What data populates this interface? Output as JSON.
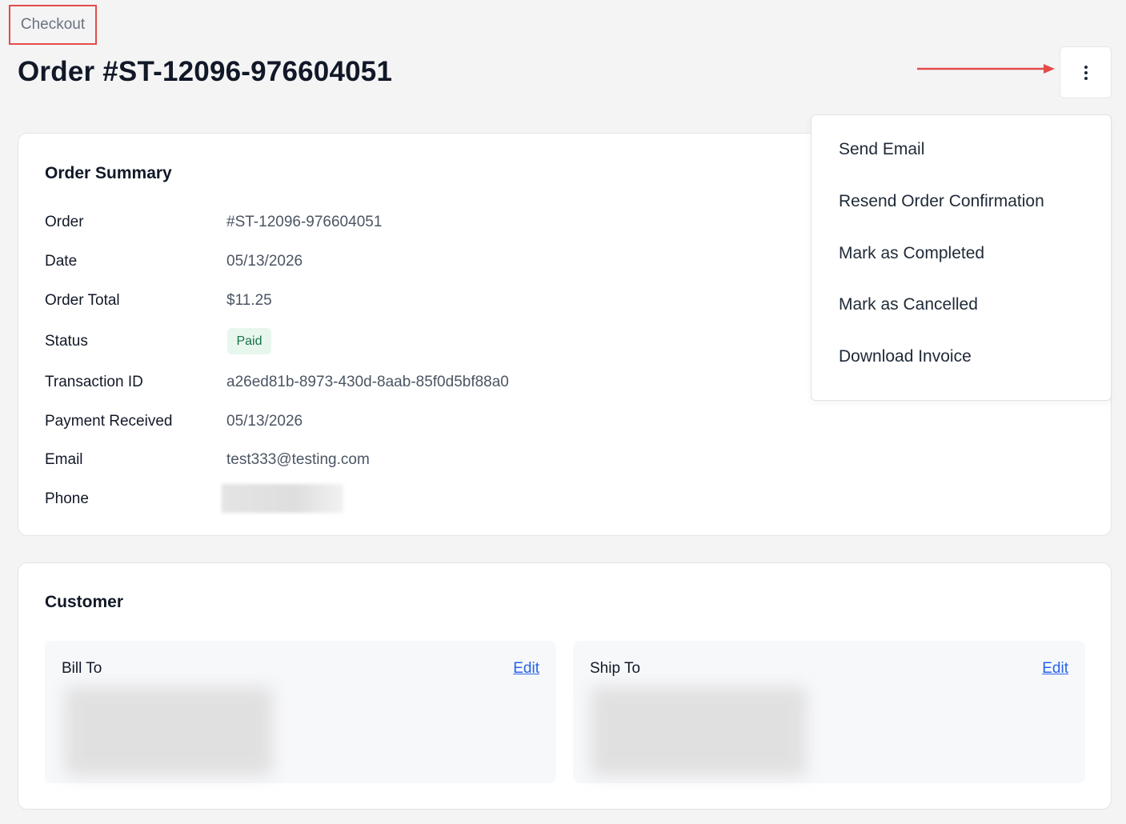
{
  "breadcrumb": {
    "label": "Checkout"
  },
  "page": {
    "title": "Order #ST-12096-976604051"
  },
  "more_menu": {
    "items": [
      {
        "label": "Send Email"
      },
      {
        "label": "Resend Order Confirmation"
      },
      {
        "label": "Mark as Completed"
      },
      {
        "label": "Mark as Cancelled"
      },
      {
        "label": "Download Invoice"
      }
    ]
  },
  "order_summary": {
    "title": "Order Summary",
    "rows": [
      {
        "label": "Order",
        "value": "#ST-12096-976604051"
      },
      {
        "label": "Date",
        "value": "05/13/2026"
      },
      {
        "label": "Order Total",
        "value": "$11.25"
      },
      {
        "label": "Status",
        "value": "Paid"
      },
      {
        "label": "Transaction ID",
        "value": "a26ed81b-8973-430d-8aab-85f0d5bf88a0"
      },
      {
        "label": "Payment Received",
        "value": "05/13/2026"
      },
      {
        "label": "Email",
        "value": "test333@testing.com"
      },
      {
        "label": "Phone",
        "value": ""
      }
    ]
  },
  "customer": {
    "title": "Customer",
    "bill_to": {
      "title": "Bill To",
      "edit_label": "Edit"
    },
    "ship_to": {
      "title": "Ship To",
      "edit_label": "Edit"
    }
  },
  "colors": {
    "highlight_border": "#e44b4b",
    "annotation_arrow": "#e44b4b",
    "paid_badge_bg": "#e8f7ee",
    "paid_badge_text": "#157347",
    "link": "#2563eb"
  },
  "icons": {
    "more": "vertical-ellipsis-icon",
    "annotation": "arrow-right-icon"
  }
}
